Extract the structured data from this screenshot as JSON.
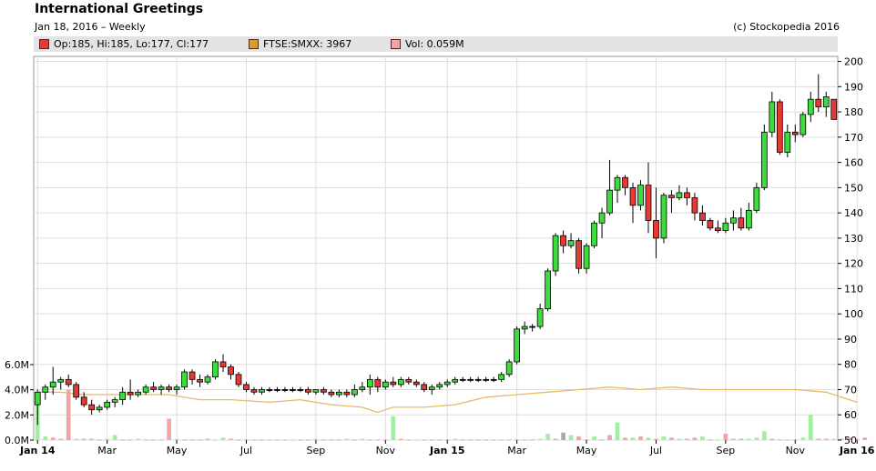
{
  "header": {
    "title": "International Greetings",
    "subtitle": "Jan 18, 2016 – Weekly",
    "copyright": "(c) Stockopedia 2016"
  },
  "legend": [
    {
      "label": "Op:185, Hi:185, Lo:177, Cl:177",
      "color": "#e53935"
    },
    {
      "label": "FTSE:SMXX: 3967",
      "color": "#d99a3a"
    },
    {
      "label": "Vol: 0.059M",
      "color": "#f4a3a3"
    }
  ],
  "chart_data": {
    "type": "candlestick",
    "interval": "weekly",
    "price_axis": {
      "ticks": [
        50,
        60,
        70,
        80,
        90,
        100,
        110,
        120,
        130,
        140,
        150,
        160,
        170,
        180,
        190,
        200
      ],
      "range": [
        50,
        202
      ]
    },
    "volume_axis": {
      "ticks": [
        "0.0M",
        "2.0M",
        "4.0M",
        "6.0M"
      ],
      "values": [
        0,
        2,
        4,
        6
      ],
      "unit": "M"
    },
    "x_ticks": [
      {
        "label": "Jan 14",
        "week": 0,
        "bold": true
      },
      {
        "label": "Mar",
        "week": 9,
        "bold": false
      },
      {
        "label": "May",
        "week": 18,
        "bold": false
      },
      {
        "label": "Jul",
        "week": 27,
        "bold": false
      },
      {
        "label": "Sep",
        "week": 36,
        "bold": false
      },
      {
        "label": "Nov",
        "week": 45,
        "bold": false
      },
      {
        "label": "Jan 15",
        "week": 53,
        "bold": true
      },
      {
        "label": "Mar",
        "week": 62,
        "bold": false
      },
      {
        "label": "May",
        "week": 71,
        "bold": false
      },
      {
        "label": "Jul",
        "week": 80,
        "bold": false
      },
      {
        "label": "Sep",
        "week": 89,
        "bold": false
      },
      {
        "label": "Nov",
        "week": 98,
        "bold": false
      },
      {
        "label": "Jan 16",
        "week": 106,
        "bold": true
      }
    ],
    "ohlc": [
      [
        64,
        70,
        56,
        69
      ],
      [
        69,
        72,
        66,
        71
      ],
      [
        71,
        79,
        68,
        73
      ],
      [
        73,
        75,
        70,
        74
      ],
      [
        74,
        76,
        71,
        72
      ],
      [
        72,
        73,
        66,
        67
      ],
      [
        67,
        69,
        63,
        64
      ],
      [
        64,
        66,
        60,
        62
      ],
      [
        62,
        64,
        61,
        63
      ],
      [
        63,
        66,
        62,
        65
      ],
      [
        65,
        67,
        63,
        66
      ],
      [
        66,
        71,
        64,
        69
      ],
      [
        69,
        74,
        66,
        68
      ],
      [
        68,
        70,
        67,
        69
      ],
      [
        69,
        72,
        68,
        71
      ],
      [
        71,
        73,
        69,
        70
      ],
      [
        70,
        72,
        68,
        71
      ],
      [
        71,
        72,
        69,
        70
      ],
      [
        70,
        72,
        68,
        71
      ],
      [
        71,
        78,
        70,
        77
      ],
      [
        77,
        78,
        72,
        74
      ],
      [
        74,
        76,
        71,
        73
      ],
      [
        73,
        76,
        72,
        75
      ],
      [
        75,
        82,
        74,
        81
      ],
      [
        81,
        84,
        77,
        79
      ],
      [
        79,
        80,
        74,
        76
      ],
      [
        76,
        77,
        71,
        72
      ],
      [
        72,
        73,
        69,
        70
      ],
      [
        70,
        71,
        68,
        69
      ],
      [
        69,
        71,
        68,
        70
      ],
      [
        70,
        71,
        69,
        70
      ],
      [
        70,
        71,
        69,
        70
      ],
      [
        70,
        71,
        69,
        70
      ],
      [
        70,
        71,
        69,
        70
      ],
      [
        70,
        71,
        69,
        70
      ],
      [
        70,
        71,
        68,
        69
      ],
      [
        69,
        70,
        68,
        70
      ],
      [
        70,
        71,
        68,
        69
      ],
      [
        69,
        70,
        67,
        68
      ],
      [
        68,
        70,
        67,
        69
      ],
      [
        69,
        70,
        67,
        68
      ],
      [
        68,
        72,
        67,
        70
      ],
      [
        70,
        73,
        69,
        71
      ],
      [
        71,
        76,
        68,
        74
      ],
      [
        74,
        75,
        69,
        71
      ],
      [
        71,
        74,
        70,
        73
      ],
      [
        73,
        75,
        71,
        72
      ],
      [
        72,
        75,
        71,
        74
      ],
      [
        74,
        75,
        72,
        73
      ],
      [
        73,
        74,
        71,
        72
      ],
      [
        72,
        73,
        69,
        70
      ],
      [
        70,
        72,
        68,
        71
      ],
      [
        71,
        73,
        70,
        72
      ],
      [
        72,
        74,
        71,
        73
      ],
      [
        73,
        75,
        72,
        74
      ],
      [
        74,
        75,
        73,
        74
      ],
      [
        74,
        75,
        73,
        74
      ],
      [
        74,
        75,
        73,
        74
      ],
      [
        74,
        75,
        73,
        74
      ],
      [
        74,
        75,
        73,
        74
      ],
      [
        74,
        77,
        73,
        76
      ],
      [
        76,
        82,
        75,
        81
      ],
      [
        81,
        95,
        80,
        94
      ],
      [
        94,
        97,
        92,
        95
      ],
      [
        95,
        96,
        93,
        95
      ],
      [
        95,
        104,
        94,
        102
      ],
      [
        102,
        118,
        101,
        117
      ],
      [
        117,
        132,
        115,
        131
      ],
      [
        131,
        133,
        124,
        127
      ],
      [
        127,
        132,
        126,
        129
      ],
      [
        129,
        130,
        116,
        118
      ],
      [
        118,
        128,
        116,
        127
      ],
      [
        127,
        137,
        126,
        136
      ],
      [
        136,
        142,
        130,
        140
      ],
      [
        140,
        161,
        139,
        149
      ],
      [
        149,
        155,
        144,
        154
      ],
      [
        154,
        155,
        147,
        150
      ],
      [
        150,
        152,
        136,
        143
      ],
      [
        143,
        153,
        141,
        151
      ],
      [
        151,
        160,
        132,
        137
      ],
      [
        137,
        150,
        122,
        130
      ],
      [
        130,
        148,
        128,
        147
      ],
      [
        147,
        149,
        140,
        146
      ],
      [
        146,
        151,
        145,
        148
      ],
      [
        148,
        150,
        143,
        146
      ],
      [
        146,
        148,
        137,
        140
      ],
      [
        140,
        143,
        135,
        137
      ],
      [
        137,
        138,
        133,
        134
      ],
      [
        134,
        137,
        132,
        133
      ],
      [
        133,
        138,
        132,
        136
      ],
      [
        136,
        141,
        133,
        138
      ],
      [
        138,
        142,
        133,
        134
      ],
      [
        134,
        144,
        133,
        141
      ],
      [
        141,
        152,
        140,
        150
      ],
      [
        150,
        175,
        149,
        172
      ],
      [
        172,
        188,
        170,
        184
      ],
      [
        184,
        185,
        163,
        164
      ],
      [
        164,
        175,
        162,
        172
      ],
      [
        172,
        175,
        168,
        171
      ],
      [
        171,
        180,
        170,
        179
      ],
      [
        179,
        188,
        176,
        185
      ],
      [
        185,
        195,
        180,
        182
      ],
      [
        182,
        188,
        178,
        186
      ],
      [
        185,
        185,
        177,
        177
      ]
    ],
    "volume": [
      [
        3.0,
        1
      ],
      [
        0.3,
        1
      ],
      [
        0.2,
        0
      ],
      [
        0.1,
        0
      ],
      [
        4.0,
        0
      ],
      [
        0.1,
        1
      ],
      [
        0.1,
        0
      ],
      [
        0.1,
        0
      ],
      [
        0.05,
        0
      ],
      [
        0.1,
        1
      ],
      [
        0.4,
        1
      ],
      [
        0.05,
        0
      ],
      [
        0.05,
        0
      ],
      [
        0.1,
        1
      ],
      [
        0.05,
        0
      ],
      [
        0.05,
        0
      ],
      [
        0.05,
        0
      ],
      [
        1.7,
        0
      ],
      [
        0.1,
        1
      ],
      [
        0.05,
        0
      ],
      [
        0.05,
        0
      ],
      [
        0.05,
        0
      ],
      [
        0.1,
        0
      ],
      [
        0.05,
        1
      ],
      [
        0.2,
        1
      ],
      [
        0.1,
        0
      ],
      [
        0.05,
        0
      ],
      [
        0.05,
        0
      ],
      [
        0.05,
        0
      ],
      [
        0.05,
        0
      ],
      [
        0.05,
        0
      ],
      [
        0.05,
        0
      ],
      [
        0.05,
        0
      ],
      [
        0.05,
        1
      ],
      [
        0.05,
        0
      ],
      [
        0.05,
        0
      ],
      [
        0.1,
        1
      ],
      [
        0.05,
        0
      ],
      [
        0.05,
        0
      ],
      [
        0.05,
        0
      ],
      [
        0.1,
        1
      ],
      [
        0.05,
        0
      ],
      [
        0.1,
        1
      ],
      [
        0.05,
        0
      ],
      [
        0.05,
        0
      ],
      [
        0.05,
        0
      ],
      [
        1.9,
        1
      ],
      [
        0.1,
        0
      ],
      [
        0.05,
        0
      ],
      [
        0.05,
        1
      ],
      [
        0.05,
        0
      ],
      [
        0.05,
        0
      ],
      [
        0.05,
        0
      ],
      [
        0.05,
        0
      ],
      [
        0.1,
        1
      ],
      [
        0.05,
        0
      ],
      [
        0.05,
        0
      ],
      [
        0.05,
        0
      ],
      [
        0.05,
        0
      ],
      [
        0.05,
        0
      ],
      [
        0.05,
        0
      ],
      [
        0.05,
        0
      ],
      [
        0.05,
        0
      ],
      [
        0.05,
        0
      ],
      [
        0.05,
        0
      ],
      [
        0.1,
        1
      ],
      [
        0.5,
        1
      ],
      [
        0.1,
        0
      ],
      [
        0.6,
        2
      ],
      [
        0.4,
        1
      ],
      [
        0.3,
        0
      ],
      [
        0.05,
        0
      ],
      [
        0.3,
        1
      ],
      [
        0.05,
        0
      ],
      [
        0.4,
        0
      ],
      [
        1.4,
        1
      ],
      [
        0.2,
        0
      ],
      [
        0.2,
        1
      ],
      [
        0.3,
        0
      ],
      [
        0.2,
        1
      ],
      [
        0.1,
        0
      ],
      [
        0.3,
        1
      ],
      [
        0.2,
        0
      ],
      [
        0.1,
        1
      ],
      [
        0.1,
        0
      ],
      [
        0.2,
        0
      ],
      [
        0.3,
        1
      ],
      [
        0.05,
        0
      ],
      [
        0.05,
        1
      ],
      [
        0.5,
        0
      ],
      [
        0.1,
        0
      ],
      [
        0.1,
        0
      ],
      [
        0.1,
        1
      ],
      [
        0.2,
        1
      ],
      [
        0.7,
        1
      ],
      [
        0.1,
        0
      ],
      [
        0.05,
        0
      ],
      [
        0.05,
        0
      ],
      [
        0.05,
        0
      ],
      [
        0.2,
        1
      ],
      [
        2.0,
        1
      ],
      [
        0.1,
        0
      ],
      [
        0.1,
        0
      ],
      [
        0.1,
        1
      ],
      [
        0.1,
        0
      ],
      [
        0.2,
        0
      ],
      [
        0.1,
        0
      ],
      [
        0.2,
        0
      ]
    ],
    "index_line": [
      [
        0,
        69
      ],
      [
        3,
        69
      ],
      [
        6,
        68
      ],
      [
        10,
        68
      ],
      [
        14,
        68
      ],
      [
        17,
        68
      ],
      [
        21,
        66
      ],
      [
        25,
        66
      ],
      [
        30,
        65
      ],
      [
        34,
        66
      ],
      [
        38,
        64
      ],
      [
        42,
        63
      ],
      [
        44,
        61
      ],
      [
        46,
        63
      ],
      [
        50,
        63
      ],
      [
        54,
        64
      ],
      [
        58,
        67
      ],
      [
        62,
        68
      ],
      [
        66,
        69
      ],
      [
        70,
        70
      ],
      [
        74,
        71
      ],
      [
        78,
        70
      ],
      [
        82,
        71
      ],
      [
        86,
        70
      ],
      [
        90,
        70
      ],
      [
        94,
        70
      ],
      [
        98,
        70
      ],
      [
        102,
        69
      ],
      [
        106,
        65
      ]
    ],
    "colors": {
      "up": "#3ddc3d",
      "down": "#e53935",
      "index": "#e8b86a",
      "vol_up": "#9ef09e",
      "vol_down": "#f4a3a3",
      "vol_flat": "#aaaaaa"
    }
  }
}
